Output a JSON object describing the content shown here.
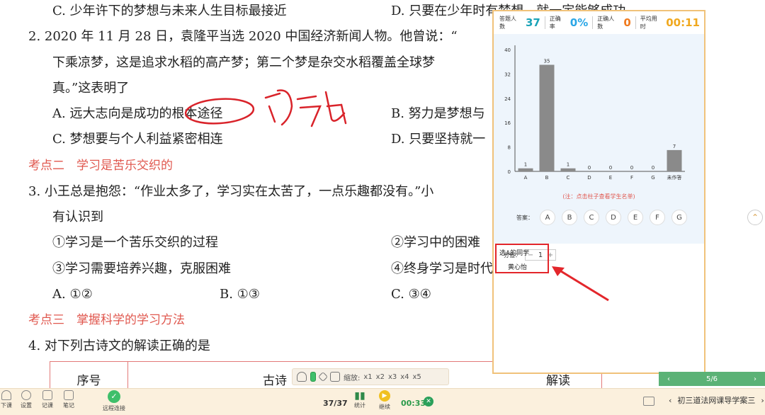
{
  "document": {
    "lines": [
      {
        "key": "l1a",
        "text": "C. 少年许下的梦想与未来人生目标最接近"
      },
      {
        "key": "l1b",
        "text": "D. 只要在少年时有梦想，就一定能够成功"
      },
      {
        "key": "q2a",
        "text": "2. 2020 年 11 月 28 日，袁隆平当选 2020 中国经济新闻人物。他曾说：“"
      },
      {
        "key": "q2b",
        "text": "下乘凉梦，这是追求水稻的高产梦；第二个梦是杂交水稻覆盖全球梦"
      },
      {
        "key": "q2c",
        "text": "真。”这表明了"
      },
      {
        "key": "q2A",
        "text": "A. 远大志向是成功的根本途径"
      },
      {
        "key": "q2B",
        "text": "B. 努力是梦想与"
      },
      {
        "key": "q2C",
        "text": "C. 梦想要与个人利益紧密相连"
      },
      {
        "key": "q2D",
        "text": "D. 只要坚持就一"
      },
      {
        "key": "sec2",
        "text": "考点二　学习是苦乐交织的"
      },
      {
        "key": "q3a",
        "text": "3. 小王总是抱怨：“作业太多了，学习实在太苦了，一点乐趣都没有。”小"
      },
      {
        "key": "q3b",
        "text": "有认识到"
      },
      {
        "key": "o1",
        "text": "①学习是一个苦乐交织的过程"
      },
      {
        "key": "o2",
        "text": "②学习中的困难"
      },
      {
        "key": "o3",
        "text": "③学习需要培养兴趣，克服困难"
      },
      {
        "key": "o4",
        "text": "④终身学习是时代"
      },
      {
        "key": "q3A",
        "text": "A. ①②"
      },
      {
        "key": "q3B",
        "text": "B. ①③"
      },
      {
        "key": "q3C",
        "text": "C. ③④"
      },
      {
        "key": "sec3",
        "text": "考点三　掌握科学的学习方法"
      },
      {
        "key": "q4",
        "text": "4. 对下列古诗文的解读正确的是"
      }
    ],
    "table_headers": [
      "序号",
      "古诗",
      "解读"
    ]
  },
  "mini_toolbar": {
    "zoom_label": "缩放:",
    "zooms": [
      "x1",
      "x2",
      "x3",
      "x4",
      "x5"
    ]
  },
  "panel": {
    "stats": [
      {
        "label": "答题人数",
        "value": "37",
        "color": "#1aa3b8"
      },
      {
        "label": "正确率",
        "value": "0%",
        "color": "#2aa6e6"
      },
      {
        "label": "正确人数",
        "value": "0",
        "color": "#f07a1e"
      },
      {
        "label": "平均用时",
        "value": "00:11",
        "color": "#f0a81e"
      }
    ],
    "note": "(注：点击柱子查看学生名单)",
    "answer_label": "答案：",
    "answers": [
      "A",
      "B",
      "C",
      "D",
      "E",
      "F",
      "G"
    ],
    "score_label": "分值：",
    "score_value": "1",
    "selected_title": "选A的同学",
    "selected_student": "黄心怡"
  },
  "chart_data": {
    "type": "bar",
    "categories": [
      "A",
      "B",
      "C",
      "D",
      "E",
      "F",
      "G",
      "未作答"
    ],
    "values": [
      1,
      35,
      1,
      0,
      0,
      0,
      0,
      7
    ],
    "yticks": [
      0,
      8,
      16,
      24,
      32,
      40
    ],
    "ylim": [
      0,
      40
    ],
    "bar_color": "#8a8a8a"
  },
  "side_nav": {
    "page": "5/6",
    "prev": "‹",
    "next": "›"
  },
  "bottom_bar": {
    "items": [
      {
        "key": "class_end",
        "label": "下课"
      },
      {
        "key": "settings",
        "label": "设置"
      },
      {
        "key": "record",
        "label": "记课"
      },
      {
        "key": "notes",
        "label": "笔记"
      }
    ],
    "remote": "远程连接",
    "count": "37/37",
    "stats_label": "统计",
    "continue_label": "继续",
    "timer": "00:33",
    "doc_name": "初三道法网课导学案三"
  }
}
